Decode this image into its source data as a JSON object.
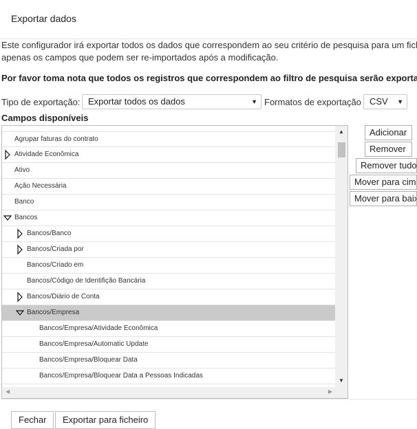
{
  "dialog": {
    "title": "Exportar dados"
  },
  "description": {
    "line1": "Este configurador irá exportar todos os dados que correspondem ao seu critério de pesquisa para um ficheiro",
    "line2": "apenas os campos que podem ser re-importados após a modificação."
  },
  "note": "Por favor toma nota que todos os registros que correspondem ao filtro de pesquisa serão exportados",
  "export_type": {
    "label": "Tipo de exportação:",
    "value": "Exportar todos os dados"
  },
  "export_format": {
    "label": "Formatos de exportação",
    "value": "CSV"
  },
  "fields": {
    "label": "Campos disponíveis",
    "items": [
      {
        "label": "Agrupar faturas do contrato",
        "level": 0,
        "toggle": "none"
      },
      {
        "label": "Atividade Econômica",
        "level": 0,
        "toggle": "collapsed"
      },
      {
        "label": "Ativo",
        "level": 0,
        "toggle": "none"
      },
      {
        "label": "Ação Necessária",
        "level": 0,
        "toggle": "none"
      },
      {
        "label": "Banco",
        "level": 0,
        "toggle": "none"
      },
      {
        "label": "Bancos",
        "level": 0,
        "toggle": "expanded"
      },
      {
        "label": "Bancos/Banco",
        "level": 1,
        "toggle": "collapsed"
      },
      {
        "label": "Bancos/Criada por",
        "level": 1,
        "toggle": "collapsed"
      },
      {
        "label": "Bancos/Criado em",
        "level": 1,
        "toggle": "none"
      },
      {
        "label": "Bancos/Código de Identifição Bancária",
        "level": 1,
        "toggle": "none"
      },
      {
        "label": "Bancos/Diário de Conta",
        "level": 1,
        "toggle": "collapsed"
      },
      {
        "label": "Bancos/Empresa",
        "level": 1,
        "toggle": "expanded",
        "selected": true
      },
      {
        "label": "Bancos/Empresa/Atividade Econômica",
        "level": 2,
        "toggle": "none"
      },
      {
        "label": "Bancos/Empresa/Automatic Update",
        "level": 2,
        "toggle": "none"
      },
      {
        "label": "Bancos/Empresa/Bloquear Data",
        "level": 2,
        "toggle": "none"
      },
      {
        "label": "Bancos/Empresa/Bloquear Data a Pessoas Indicadas",
        "level": 2,
        "toggle": "none"
      }
    ]
  },
  "actions": {
    "add": "Adicionar",
    "remove": "Remover",
    "remove_all": "Remover tudo",
    "move_up": "Mover para cima",
    "move_down": "Mover para baixo"
  },
  "footer": {
    "close": "Fechar",
    "export": "Exportar para ficheiro"
  }
}
